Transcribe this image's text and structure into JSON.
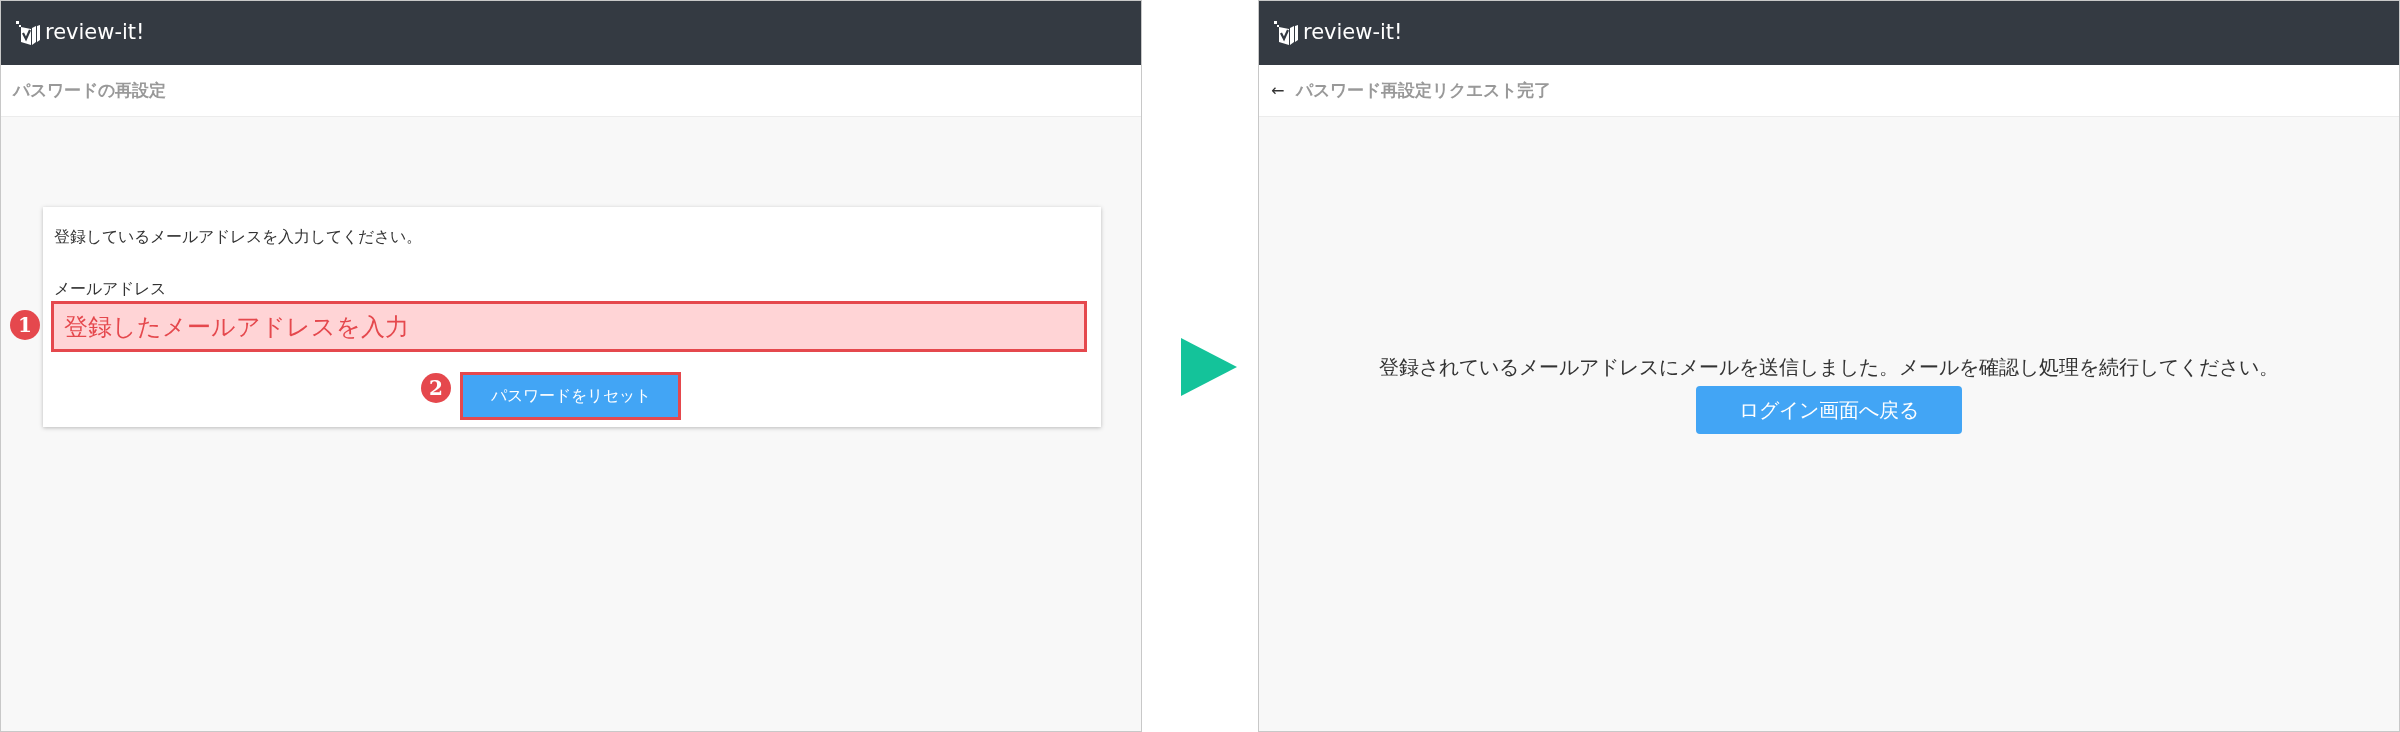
{
  "screens": [
    {
      "kind": "form",
      "brand": "review-it!",
      "page_title": "パスワードの再設定",
      "instruction": "登録しているメールアドレスを入力してください。",
      "field_label": "メールアドレス",
      "field": {
        "placeholder": "登録したメールアドレスを入力",
        "step": "1",
        "highlighted": true
      },
      "button": {
        "label": "パスワードをリセット",
        "step": "2",
        "highlighted": true
      }
    },
    {
      "kind": "result",
      "brand": "review-it!",
      "page_title": "パスワード再設定リクエスト完了",
      "back_icon": "←",
      "message": "登録されているメールアドレスにメールを送信しました。メールを確認し処理を続行してください。",
      "button": {
        "label": "ログイン画面へ戻る"
      }
    }
  ]
}
